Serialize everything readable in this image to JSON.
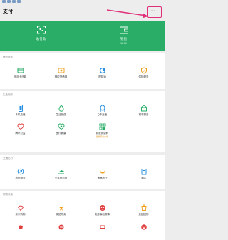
{
  "header": {
    "title": "支付"
  },
  "hero": {
    "pay": {
      "label": "收付款"
    },
    "wallet": {
      "label": "钱包",
      "balance": "¥2.80"
    }
  },
  "sections": [
    {
      "title": "腾讯服务",
      "items": [
        {
          "label": "信用卡还款",
          "icon": "credit-card-icon",
          "color": "#2aae67"
        },
        {
          "label": "微粒贷借钱",
          "icon": "loan-icon",
          "color": "#f0a020"
        },
        {
          "label": "理财通",
          "icon": "wealth-icon",
          "color": "#2a8fe0"
        },
        {
          "label": "保险服务",
          "icon": "insurance-icon",
          "color": "#f0a020"
        }
      ]
    },
    {
      "title": "生活服务",
      "items": [
        {
          "label": "手机充值",
          "icon": "mobile-topup-icon",
          "color": "#2a8fe0"
        },
        {
          "label": "生活缴费",
          "icon": "utility-icon",
          "color": "#2aae67"
        },
        {
          "label": "Q币充值",
          "icon": "q-coin-icon",
          "color": "#2a8fe0"
        },
        {
          "label": "城市服务",
          "icon": "city-service-icon",
          "color": "#2aae67"
        },
        {
          "label": "腾讯公益",
          "icon": "charity-icon",
          "color": "#e04040"
        },
        {
          "label": "医疗健康",
          "icon": "health-icon",
          "color": "#2aae67"
        },
        {
          "label": "防疫健康码",
          "icon": "qr-code-icon",
          "color": "#2aae67",
          "badge": "国务院客户端"
        }
      ]
    },
    {
      "title": "交通出行",
      "items": [
        {
          "label": "出行服务",
          "icon": "travel-icon",
          "color": "#2a8fe0"
        },
        {
          "label": "火车票机票",
          "icon": "train-icon",
          "color": "#2aae67"
        },
        {
          "label": "滴滴出行",
          "icon": "didi-icon",
          "color": "#f0a020"
        },
        {
          "label": "酒店",
          "icon": "hotel-icon",
          "color": "#2a8fe0"
        }
      ]
    },
    {
      "title": "购物消费",
      "items": [
        {
          "label": "京东购物",
          "icon": "jd-icon",
          "color": "#e04040"
        },
        {
          "label": "美团外卖",
          "icon": "meituan-icon",
          "color": "#f0a020"
        },
        {
          "label": "电影演出赛事",
          "icon": "movie-icon",
          "color": "#e04040"
        },
        {
          "label": "美团团购",
          "icon": "group-buy-icon",
          "color": "#f0a020"
        },
        {
          "label": "",
          "icon": "shopping-icon",
          "color": "#e04040"
        },
        {
          "label": "",
          "icon": "bargain-icon",
          "color": "#e04040"
        },
        {
          "label": "",
          "icon": "pdd-icon",
          "color": "#e04040"
        },
        {
          "label": "",
          "icon": "vip-icon",
          "color": "#e04040"
        }
      ]
    }
  ]
}
